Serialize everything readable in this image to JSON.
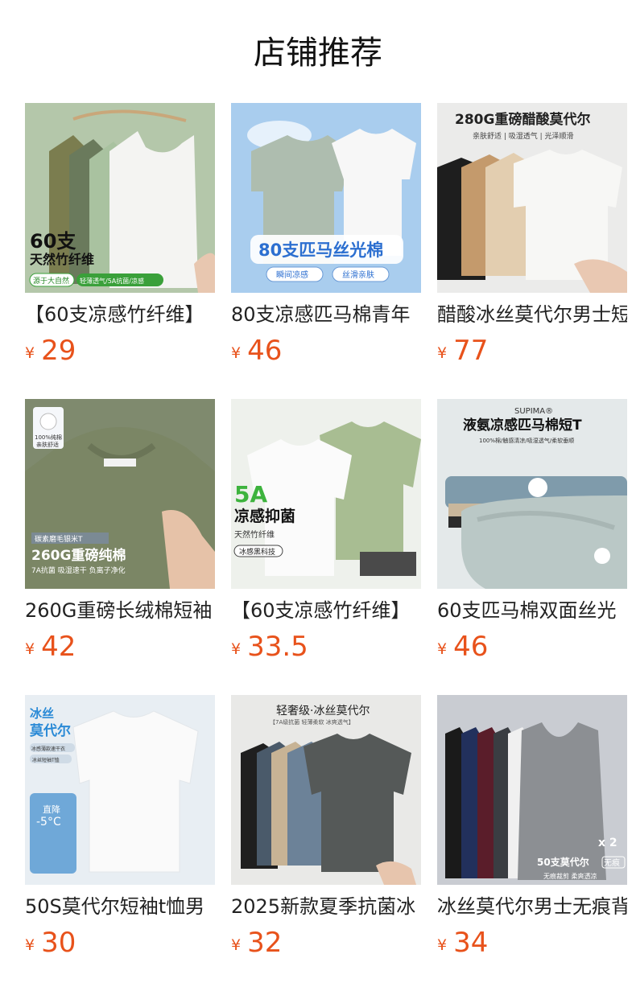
{
  "page": {
    "title": "店铺推荐"
  },
  "currency_symbol": "¥",
  "products": [
    {
      "name": "【60支凉感竹纤维】",
      "price": "29",
      "image_text": [
        "60支",
        "天然竹纤维",
        "源于大自然",
        "轻薄透气/5A抗菌/凉感"
      ]
    },
    {
      "name": "80支凉感匹马棉青年",
      "price": "46",
      "image_text": [
        "80支匹马丝光棉",
        "瞬间凉感",
        "丝滑亲肤"
      ]
    },
    {
      "name": "醋酸冰丝莫代尔男士短",
      "price": "77",
      "image_text": [
        "280G重磅醋酸莫代尔",
        "亲肤舒适 | 吸湿透气 | 光泽顺滑"
      ]
    },
    {
      "name": "260G重磅长绒棉短袖",
      "price": "42",
      "image_text": [
        "100%纯棉",
        "亲肤舒适",
        "碳素磨毛银米T",
        "260G重磅纯棉",
        "7A抗菌  吸湿速干  负离子净化"
      ]
    },
    {
      "name": "【60支凉感竹纤维】",
      "price": "33.5",
      "image_text": [
        "5A",
        "凉感抑菌",
        "天然竹纤维",
        "冰感黑科技"
      ]
    },
    {
      "name": "60支匹马棉双面丝光",
      "price": "46",
      "image_text": [
        "SUPIMA®",
        "液氨凉感匹马棉短T",
        "100%棉/触感清凉/吸湿透气/柔软垂顺"
      ]
    },
    {
      "name": "50S莫代尔短袖t恤男",
      "price": "30",
      "image_text": [
        "冰丝",
        "莫代尔",
        "冰感薄款速干衣",
        "冰丝短袖T恤",
        "直降",
        "-5°C"
      ]
    },
    {
      "name": "2025新款夏季抗菌冰",
      "price": "32",
      "image_text": [
        "轻奢级·冰丝莫代尔",
        "【7A级抗菌 轻薄柔软 冰爽透气】"
      ]
    },
    {
      "name": "冰丝莫代尔男士无痕背",
      "price": "34",
      "image_text": [
        "x 2",
        "50支莫代尔",
        "无痕",
        "无痕裁剪 柔爽透凉"
      ]
    }
  ]
}
